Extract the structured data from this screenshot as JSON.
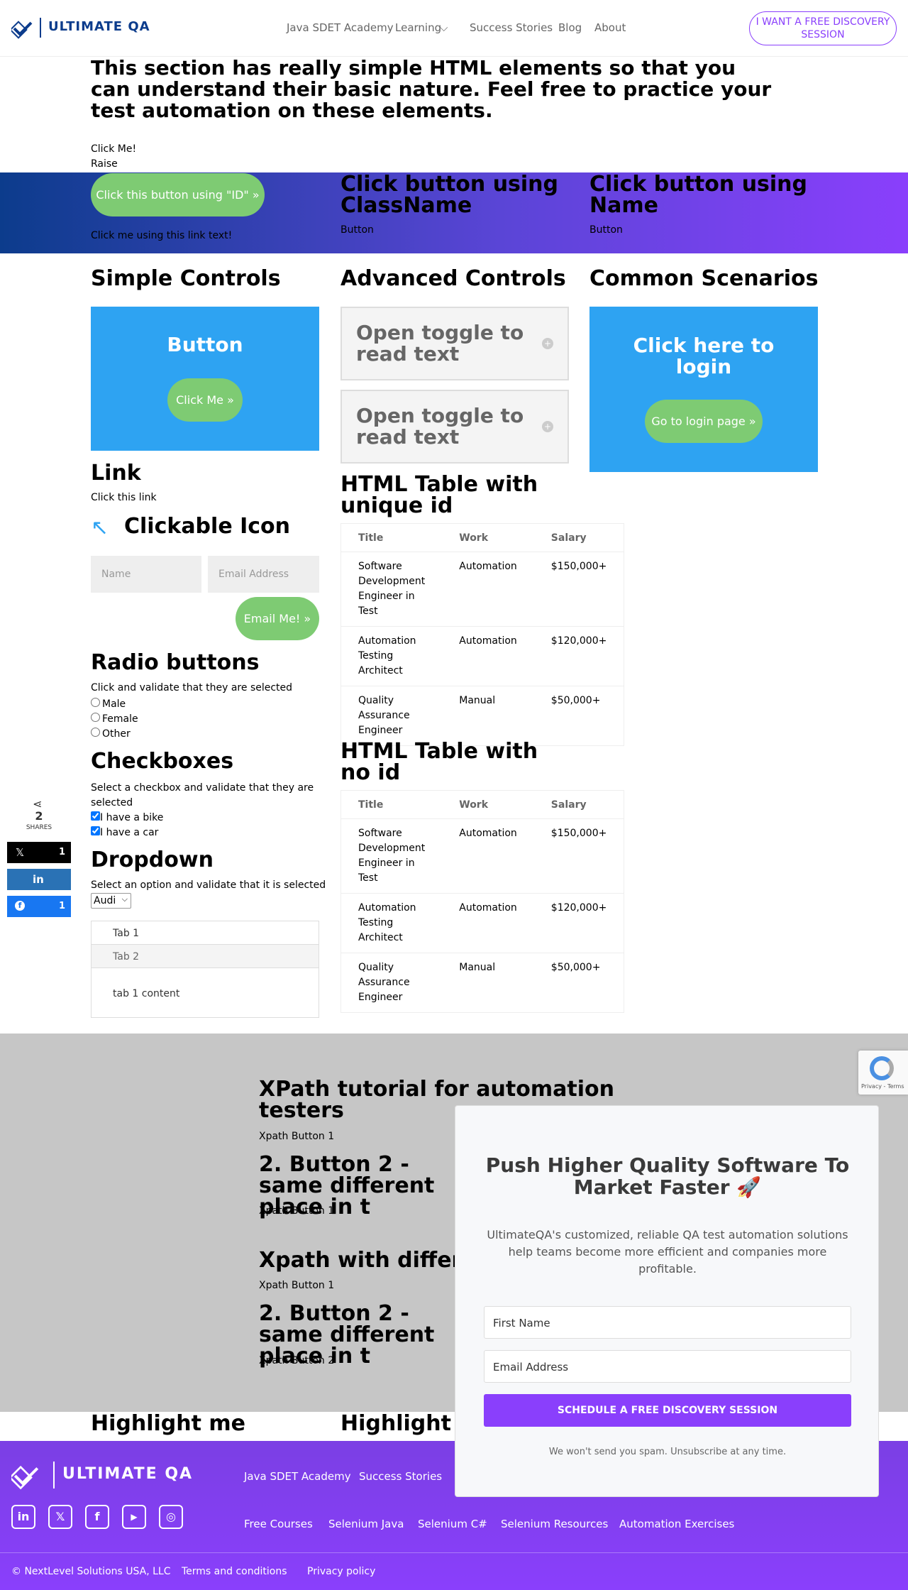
{
  "header": {
    "logo_text": "ULTIMATE QA",
    "nav": [
      "Java SDET Academy",
      "Learning",
      "Success Stories",
      "Blog",
      "About"
    ],
    "cta": "I WANT A FREE DISCOVERY SESSION"
  },
  "intro": {
    "heading": "This section has really simple HTML elements so that you can understand their basic nature. Feel free to practice your test automation on these elements.",
    "click_me": "Click Me!",
    "raise": "Raise"
  },
  "band": {
    "id_button": "Click this button using \"ID\"",
    "link_text": "Click me using this link text!",
    "classname_heading": "Click button using ClassName",
    "classname_button": "Button",
    "name_heading": "Click button using Name",
    "name_button": "Button"
  },
  "simple": {
    "heading": "Simple Controls",
    "box_title": "Button",
    "box_button": "Click Me",
    "link_heading": "Link",
    "link_text": "Click this link",
    "icon_heading": "Clickable Icon",
    "name_placeholder": "Name",
    "email_placeholder": "Email Address",
    "email_button": "Email Me!",
    "radio_heading": "Radio buttons",
    "radio_desc": "Click and validate that they are selected",
    "radios": [
      "Male",
      "Female",
      "Other"
    ],
    "checkbox_heading": "Checkboxes",
    "checkbox_desc": "Select a checkbox and validate that they are selected",
    "checkboxes": [
      "I have a bike",
      "I have a car"
    ],
    "dropdown_heading": "Dropdown",
    "dropdown_desc": "Select an option and validate that it is selected",
    "dropdown_value": "Audi",
    "tabs": [
      "Tab 1",
      "Tab 2"
    ],
    "tab_content": "tab 1 content"
  },
  "advanced": {
    "heading": "Advanced Controls",
    "toggles": [
      "Open toggle to read text",
      "Open toggle to read text"
    ],
    "table1_heading": "HTML Table with unique id",
    "table2_heading": "HTML Table with no id",
    "columns": [
      "Title",
      "Work",
      "Salary"
    ],
    "rows": [
      [
        "Software Development Engineer in Test",
        "Automation",
        "$150,000+"
      ],
      [
        "Automation Testing Architect",
        "Automation",
        "$120,000+"
      ],
      [
        "Quality Assurance Engineer",
        "Manual",
        "$50,000+"
      ]
    ]
  },
  "common": {
    "heading": "Common Scenarios",
    "box_title": "Click here to login",
    "box_button": "Go to login page"
  },
  "share": {
    "count": "2",
    "label": "SHARES",
    "x_count": "1",
    "fb_count": "1"
  },
  "xpath": {
    "h1": "XPath tutorial for automation testers",
    "b1": "Xpath Button 1",
    "h2": "2. Button 2 - same different place in t",
    "b2": "Xpath Button 1",
    "h3": "Xpath with differe",
    "b3": "Xpath Button 1",
    "h4": "2. Button 2 - same different place in t",
    "b4": "Xpath Button 2"
  },
  "highlight": {
    "left": "Highlight me",
    "mid": "Highlight m"
  },
  "recaptcha": {
    "text": "Privacy - Terms"
  },
  "popup": {
    "title": "Push Higher Quality Software To Market Faster 🚀",
    "desc": "UltimateQA's customized, reliable QA test automation solutions help teams become more efficient and companies more profitable.",
    "first_name": "First Name",
    "email": "Email Address",
    "button": "SCHEDULE A FREE DISCOVERY SESSION",
    "note": "We won't send you spam. Unsubscribe at any time."
  },
  "footer": {
    "logo_text": "ULTIMATE QA",
    "row1": [
      "Java SDET Academy",
      "Success Stories"
    ],
    "row2": [
      "Free Courses",
      "Selenium Java",
      "Selenium C#",
      "Selenium Resources",
      "Automation Exercises"
    ],
    "social": [
      "linkedin-icon",
      "x-icon",
      "facebook-icon",
      "youtube-icon",
      "instagram-icon"
    ],
    "copyright": "© NextLevel Solutions USA, LLC",
    "terms": "Terms and conditions",
    "privacy": "Privacy policy"
  },
  "colors": {
    "brand_blue": "#0c3c8c",
    "purple": "#8a3ffc",
    "green": "#7ecb73",
    "light_blue": "#2ea3f2"
  }
}
